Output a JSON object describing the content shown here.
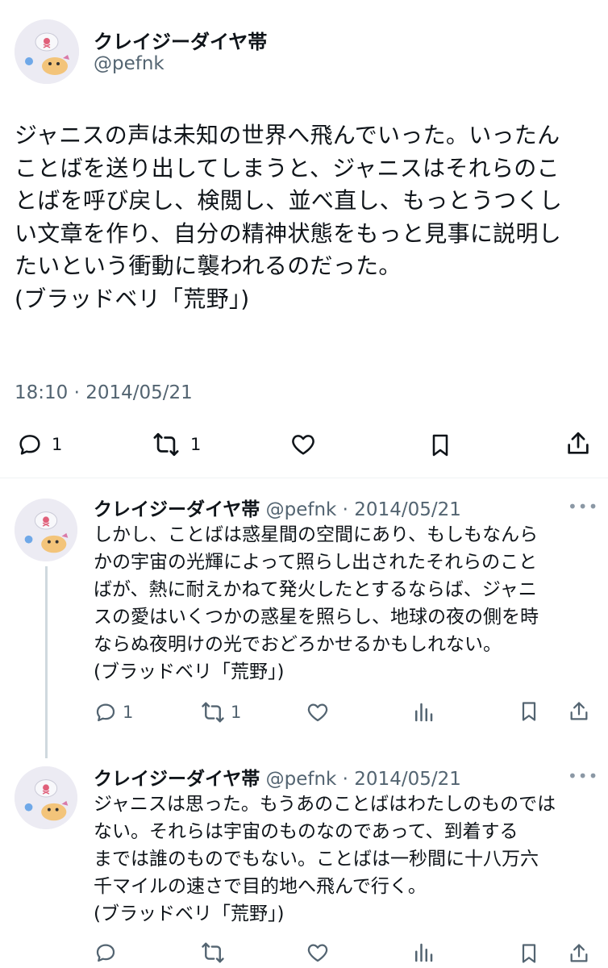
{
  "main_tweet": {
    "author_name": "クレイジーダイヤ帯",
    "handle": "@pefnk",
    "text": "ジャニスの声は未知の世界へ飛んでいった。いったん\nことばを送り出してしまうと、ジャニスはそれらのこ\nとばを呼び戻し、検閲し、並べ直し、もっとうつくし\nい文章を作り、自分の精神状態をもっと見事に説明し\nたいという衝動に襲われるのだった。\n(ブラッドベリ「荒野」)",
    "timestamp": "18:10 · 2014/05/21",
    "actions": {
      "reply_count": "1",
      "retweet_count": "1"
    }
  },
  "replies": [
    {
      "author_name": "クレイジーダイヤ帯",
      "meta": "@pefnk · 2014/05/21",
      "text": "しかし、ことばは惑星間の空間にあり、もしもなんら\nかの宇宙の光輝によって照らし出されたそれらのこと\nばが、熱に耐えかねて発火したとするならば、ジャニ\nスの愛はいくつかの惑星を照らし、地球の夜の側を時\nならぬ夜明けの光でおどろかせるかもしれない。\n(ブラッドベリ「荒野」)",
      "more": "•••",
      "actions": {
        "reply_count": "1",
        "retweet_count": "1"
      }
    },
    {
      "author_name": "クレイジーダイヤ帯",
      "meta": "@pefnk · 2014/05/21",
      "text": "ジャニスは思った。もうあのことばはわたしのものでは\nない。それらは宇宙のものなのであって、到着する\nまでは誰のものでもない。ことばは一秒間に十八万六\n千マイルの速さで目的地へ飛んで行く。\n(ブラッドベリ「荒野」)",
      "more": "•••",
      "actions": {
        "reply_count": "",
        "retweet_count": ""
      }
    }
  ],
  "colors": {
    "text": "#0f1419",
    "secondary": "#536471",
    "divider": "#eff3f4",
    "thread_line": "#cfd9de"
  }
}
